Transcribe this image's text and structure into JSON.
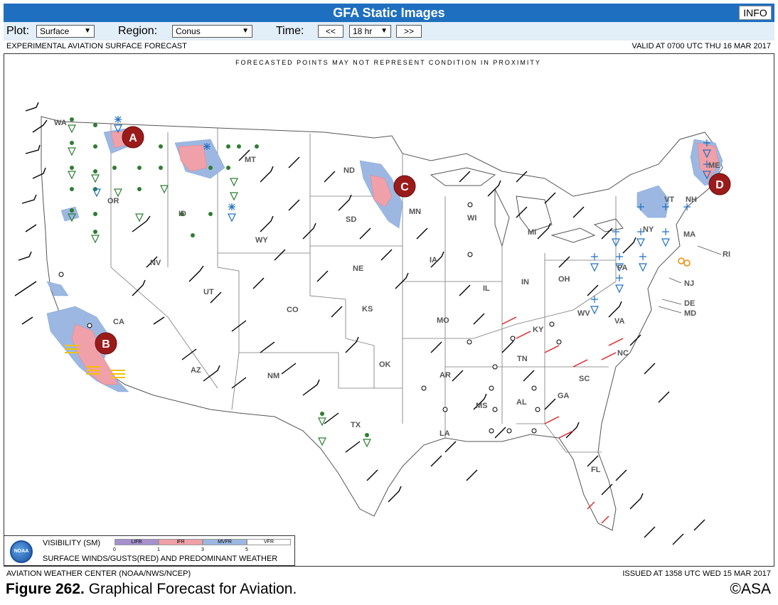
{
  "header": {
    "title": "GFA Static Images",
    "info_label": "INFO"
  },
  "controls": {
    "plot_label": "Plot:",
    "plot_value": "Surface",
    "region_label": "Region:",
    "region_value": "Conus",
    "time_label": "Time:",
    "prev_label": "<<",
    "time_value": "18 hr",
    "next_label": ">>"
  },
  "subheader": {
    "left": "EXPERIMENTAL AVIATION SURFACE FORECAST",
    "right": "VALID AT 0700 UTC THU 16 MAR 2017"
  },
  "map": {
    "note": "FORECASTED POINTS MAY NOT REPRESENT CONDITION IN PROXIMITY",
    "colors": {
      "ifr": "#f0a0a8",
      "mvfr": "#9cb8e2",
      "lifr": "#a58fcc",
      "wind": "#000000",
      "gust": "#e02020",
      "vfr_dot": "#2e7d32",
      "snow": "#1f6fc0"
    },
    "states": [
      "WA",
      "OR",
      "CA",
      "NV",
      "ID",
      "MT",
      "WY",
      "UT",
      "AZ",
      "NM",
      "CO",
      "ND",
      "SD",
      "NE",
      "KS",
      "OK",
      "TX",
      "MN",
      "IA",
      "MO",
      "AR",
      "LA",
      "WI",
      "IL",
      "MS",
      "MI",
      "IN",
      "KY",
      "TN",
      "AL",
      "OH",
      "GA",
      "SC",
      "FL",
      "WV",
      "VA",
      "NC",
      "PA",
      "NY",
      "VT",
      "NH",
      "ME",
      "MA",
      "RI",
      "NJ",
      "DE",
      "MD"
    ],
    "markers": [
      {
        "label": "A"
      },
      {
        "label": "B"
      },
      {
        "label": "C"
      },
      {
        "label": "D"
      }
    ]
  },
  "legend": {
    "visibility_label": "VISIBILITY (SM)",
    "categories": [
      {
        "name": "LIFR",
        "color": "#a58fcc"
      },
      {
        "name": "IFR",
        "color": "#f0a0a8"
      },
      {
        "name": "MVFR",
        "color": "#9cb8e2"
      },
      {
        "name": "VFR",
        "color": "#ffffff"
      }
    ],
    "ticks": [
      "0",
      "1",
      "3",
      "5"
    ],
    "winds_label": "SURFACE WINDS/GUSTS(RED) AND PREDOMINANT WEATHER",
    "logo_text": "NOAA"
  },
  "footer": {
    "left": "AVIATION WEATHER CENTER (NOAA/NWS/NCEP)",
    "right": "ISSUED AT 1358 UTC WED 15 MAR 2017"
  },
  "caption": {
    "figure": "Figure 262.",
    "text": " Graphical Forecast for Aviation.",
    "copyright": "©ASA"
  }
}
